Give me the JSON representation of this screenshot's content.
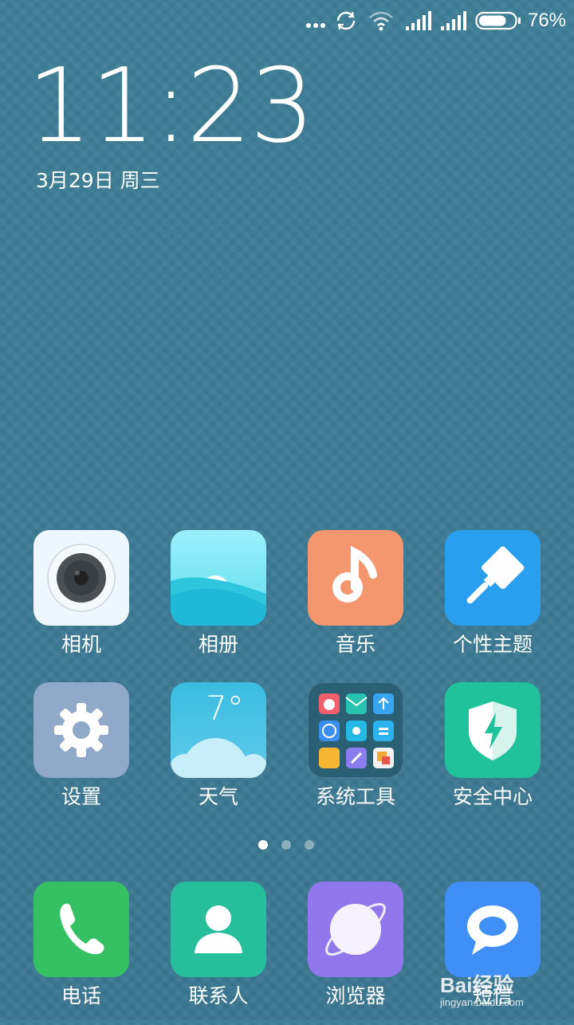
{
  "status_bar": {
    "battery_percent": "76%",
    "battery_level": 0.76
  },
  "lockscreen": {
    "time": "11:23",
    "date": "3月29日 周三"
  },
  "apps": [
    {
      "label": "相机",
      "icon": "camera-icon",
      "color": "#eaf4fb"
    },
    {
      "label": "相册",
      "icon": "gallery-icon",
      "color": "#4fd3e6"
    },
    {
      "label": "音乐",
      "icon": "music-icon",
      "color": "#f59a6f"
    },
    {
      "label": "个性主题",
      "icon": "theme-brush-icon",
      "color": "#2a9ff0"
    },
    {
      "label": "设置",
      "icon": "gear-icon",
      "color": "#8fa7c6"
    },
    {
      "label": "天气",
      "icon": "weather-icon",
      "color": "#4dbfe0",
      "temp": "7°"
    },
    {
      "label": "系统工具",
      "icon": "folder-icon",
      "color": "#2f6e84"
    },
    {
      "label": "安全中心",
      "icon": "shield-icon",
      "color": "#1fc19a"
    }
  ],
  "pager": {
    "pages": 3,
    "current": 1
  },
  "dock": [
    {
      "label": "电话",
      "icon": "phone-icon",
      "color": "#35c063"
    },
    {
      "label": "联系人",
      "icon": "contacts-icon",
      "color": "#26bf9a"
    },
    {
      "label": "浏览器",
      "icon": "browser-icon",
      "color": "#9078ec"
    },
    {
      "label": "短信",
      "icon": "message-icon",
      "color": "#3d8ff5"
    }
  ],
  "watermark": {
    "text": "Bai经验",
    "sub": "jingyan.baidu.com"
  }
}
